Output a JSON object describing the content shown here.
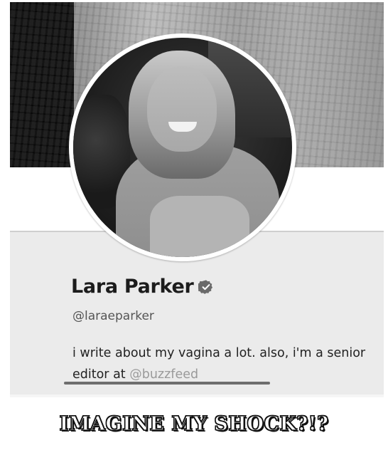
{
  "profile": {
    "display_name": "Lara Parker",
    "verified": true,
    "handle": "@laraeparker",
    "bio_text": "i write about my vagina a lot. also, i'm a senior editor at",
    "bio_mention": "@buzzfeed"
  },
  "caption": "IMAGINE MY SHOCK?!?",
  "icons": {
    "verified": "verified-badge-icon"
  },
  "colors": {
    "card_background": "#ebebeb",
    "name_text": "#1c1c1c",
    "handle_text": "#555555",
    "mention_text": "#9a9a9a",
    "caption_fill": "#ffffff",
    "caption_outline": "#111111"
  }
}
